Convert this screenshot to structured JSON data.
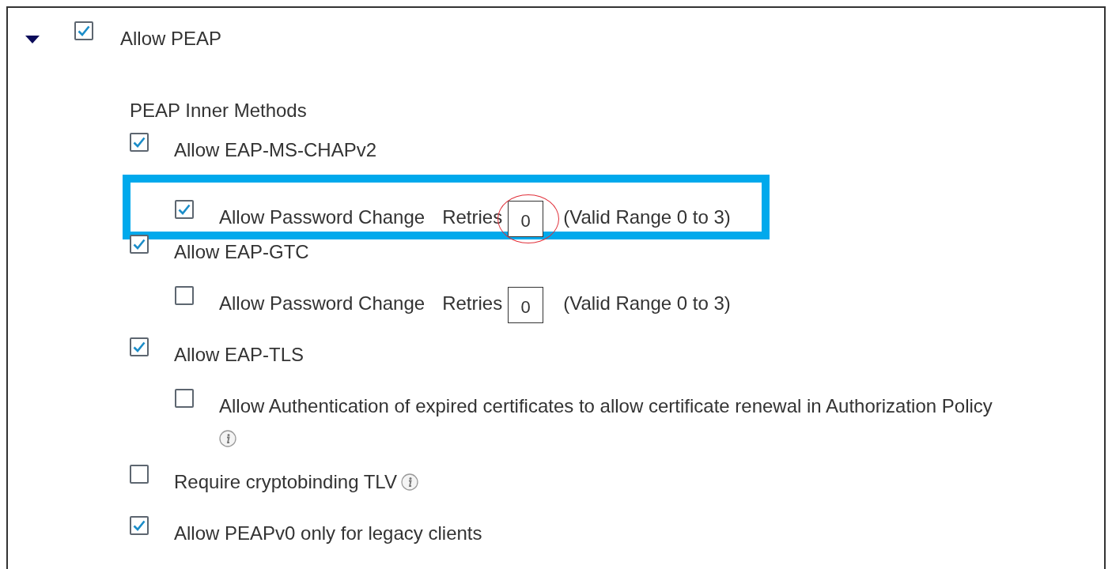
{
  "section": {
    "label": "Allow PEAP",
    "expanded": true,
    "checked": true,
    "heading": "PEAP Inner Methods",
    "options": [
      {
        "kind": "check",
        "label": "Allow EAP-MS-CHAPv2",
        "checked": true,
        "children": [
          {
            "kind": "retries",
            "label": "Allow Password Change",
            "checked": true,
            "retries_label": "Retries",
            "value": "0",
            "range": "(Valid Range 0 to 3)",
            "highlighted": true
          }
        ]
      },
      {
        "kind": "check",
        "label": "Allow EAP-GTC",
        "checked": true,
        "children": [
          {
            "kind": "retries",
            "label": "Allow Password Change",
            "checked": false,
            "retries_label": "Retries",
            "value": "0",
            "range": "(Valid Range 0 to 3)",
            "highlighted": false
          }
        ]
      },
      {
        "kind": "check",
        "label": "Allow EAP-TLS",
        "checked": true,
        "children": [
          {
            "kind": "info_below",
            "label": "Allow Authentication of expired certificates to allow certificate renewal in Authorization Policy",
            "checked": false
          }
        ]
      },
      {
        "kind": "info_inline",
        "label": "Require cryptobinding TLV",
        "checked": false
      },
      {
        "kind": "check",
        "label": "Allow PEAPv0 only for legacy clients",
        "checked": true
      }
    ]
  }
}
